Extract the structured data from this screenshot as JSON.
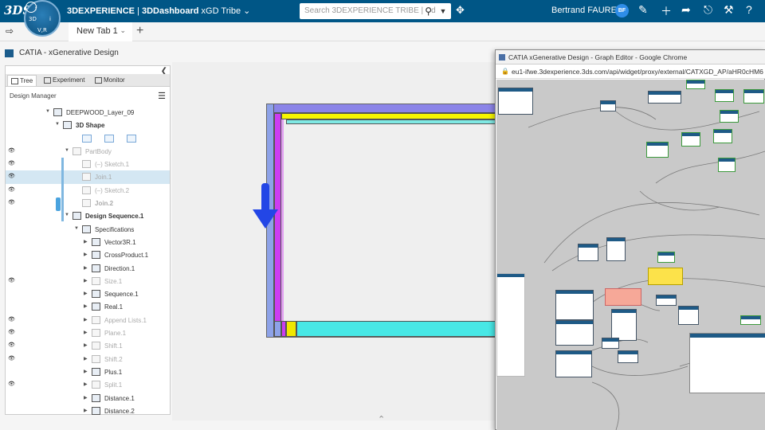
{
  "topbar": {
    "logo": "3DS",
    "compass_labels": [
      "3D",
      "V,R",
      "i",
      "f"
    ],
    "brand_prefix": "3DEXPERIENCE",
    "brand_separator": " | ",
    "brand_app": "3DDashboard",
    "brand_context": " xGD Tribe",
    "brand_chevron": "⌄",
    "search_placeholder": "Search 3DEXPERIENCE TRIBE | Cd",
    "user_name": "Bertrand FAURE",
    "avatar_initials": "BF",
    "icons": [
      "tag-icon",
      "share-icon",
      "plus-icon",
      "forward-icon",
      "network-icon",
      "tools-icon",
      "help-icon"
    ],
    "color": "#005686"
  },
  "tabs": {
    "items": [
      {
        "label": "New Tab 1"
      }
    ],
    "add": "+"
  },
  "app": {
    "title": "CATIA - xGenerative Design"
  },
  "panel": {
    "tabs": [
      {
        "label": "Tree"
      },
      {
        "label": "Experiment"
      },
      {
        "label": "Monitor"
      }
    ],
    "section": "Design Manager",
    "tree": [
      {
        "label": "DEEPWOOD_Layer_09",
        "indent": 1,
        "eye": false,
        "toggle": "▼",
        "style": "normal"
      },
      {
        "label": "3D Shape",
        "indent": 2,
        "eye": false,
        "toggle": "▼",
        "style": "bold"
      },
      {
        "label": "",
        "indent": 3,
        "eye": false,
        "toggle": "",
        "style": "axes"
      },
      {
        "label": "PartBody",
        "indent": 3,
        "eye": true,
        "toggle": "▼",
        "style": "dim"
      },
      {
        "label": "(–)  Sketch.1",
        "indent": 4,
        "eye": true,
        "toggle": "",
        "style": "dim"
      },
      {
        "label": "Join.1",
        "indent": 4,
        "eye": true,
        "toggle": "",
        "style": "dim-sel"
      },
      {
        "label": "(–)  Sketch.2",
        "indent": 4,
        "eye": true,
        "toggle": "",
        "style": "dim"
      },
      {
        "label": "Join.2",
        "indent": 4,
        "eye": true,
        "toggle": "",
        "style": "dim-bold"
      },
      {
        "label": "Design Sequence.1",
        "indent": 3,
        "eye": false,
        "toggle": "▼",
        "style": "bold"
      },
      {
        "label": "Specifications",
        "indent": 4,
        "eye": false,
        "toggle": "▼",
        "style": "normal"
      },
      {
        "label": "Vector3R.1",
        "indent": 5,
        "eye": false,
        "toggle": "▶",
        "style": "normal"
      },
      {
        "label": "CrossProduct.1",
        "indent": 5,
        "eye": false,
        "toggle": "▶",
        "style": "normal"
      },
      {
        "label": "Direction.1",
        "indent": 5,
        "eye": false,
        "toggle": "▶",
        "style": "normal"
      },
      {
        "label": "Size.1",
        "indent": 5,
        "eye": true,
        "toggle": "▶",
        "style": "dim"
      },
      {
        "label": "Sequence.1",
        "indent": 5,
        "eye": false,
        "toggle": "▶",
        "style": "normal"
      },
      {
        "label": "Real.1",
        "indent": 5,
        "eye": false,
        "toggle": "▶",
        "style": "normal"
      },
      {
        "label": "Append Lists.1",
        "indent": 5,
        "eye": true,
        "toggle": "▶",
        "style": "dim"
      },
      {
        "label": "Plane.1",
        "indent": 5,
        "eye": true,
        "toggle": "▶",
        "style": "dim"
      },
      {
        "label": "Shift.1",
        "indent": 5,
        "eye": true,
        "toggle": "▶",
        "style": "dim"
      },
      {
        "label": "Shift.2",
        "indent": 5,
        "eye": true,
        "toggle": "▶",
        "style": "dim"
      },
      {
        "label": "Plus.1",
        "indent": 5,
        "eye": false,
        "toggle": "▶",
        "style": "normal"
      },
      {
        "label": "Split.1",
        "indent": 5,
        "eye": true,
        "toggle": "▶",
        "style": "dim"
      },
      {
        "label": "Distance.1",
        "indent": 5,
        "eye": false,
        "toggle": "▶",
        "style": "normal"
      },
      {
        "label": "Distance.2",
        "indent": 5,
        "eye": false,
        "toggle": "▶",
        "style": "normal"
      }
    ]
  },
  "chrome": {
    "title": "CATIA xGenerative Design - Graph Editor - Google Chrome",
    "url": "eu1-ifwe.3dexperience.3ds.com/api/widget/proxy/external/CATXGD_AP/aHR0cHM6"
  },
  "viewport": {
    "colors": {
      "rail": "#8da2e8",
      "purple": "#cc3cf2",
      "yellow": "#f7f600",
      "cyan": "#48e8e6",
      "arrow": "#2346e6"
    }
  }
}
